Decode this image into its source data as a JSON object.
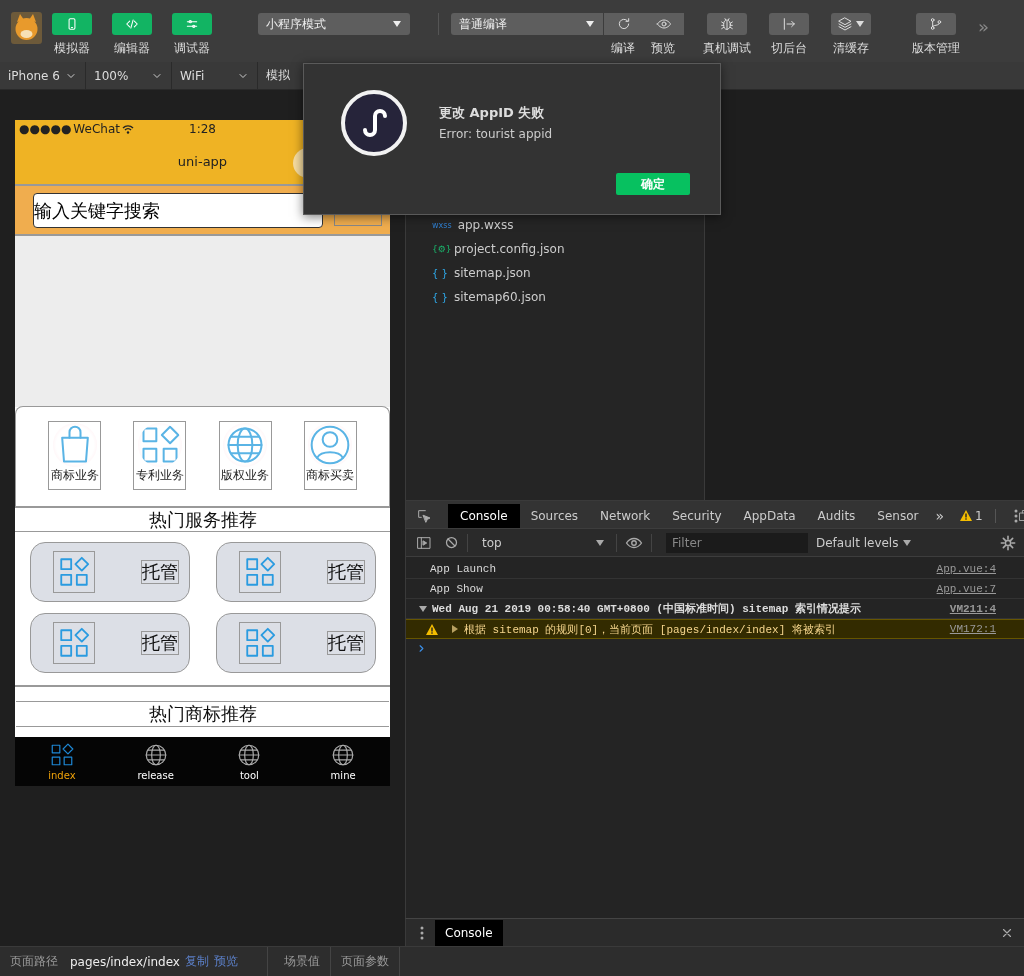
{
  "toolbar": {
    "views": [
      {
        "label": "模拟器",
        "kind": "phone",
        "on": true
      },
      {
        "label": "编辑器",
        "kind": "code",
        "on": true
      },
      {
        "label": "调试器",
        "kind": "sliders",
        "on": true
      }
    ],
    "mode": "小程序模式",
    "compile": {
      "label": "普通编译",
      "actions": [
        {
          "label": "编译",
          "kind": "refresh"
        },
        {
          "label": "预览",
          "kind": "eye"
        }
      ]
    },
    "tools": [
      {
        "label": "真机调试",
        "kind": "bug",
        "menu": false
      },
      {
        "label": "切后台",
        "kind": "exit",
        "menu": false
      },
      {
        "label": "清缓存",
        "kind": "layers",
        "menu": true
      },
      {
        "label": "版本管理",
        "kind": "branch",
        "menu": false
      }
    ],
    "more": "»"
  },
  "device_bar": [
    {
      "label": "iPhone 6",
      "kind": "select"
    },
    {
      "label": "100%",
      "kind": "select"
    },
    {
      "label": "WiFi",
      "kind": "select"
    },
    {
      "label": "模拟",
      "kind": "label"
    }
  ],
  "simulator": {
    "signal": "●●●●●",
    "carrier": "WeChat",
    "time": "1:28",
    "title": "uni-app",
    "search": {
      "placeholder": "输入关键字搜索"
    },
    "categories": [
      {
        "label": "商标业务",
        "kind": "bag"
      },
      {
        "label": "专利业务",
        "kind": "apps"
      },
      {
        "label": "版权业务",
        "kind": "globe"
      },
      {
        "label": "商标买卖",
        "kind": "user"
      }
    ],
    "service_title": "热门服务推荐",
    "services": [
      {
        "label": "托管"
      },
      {
        "label": "托管"
      },
      {
        "label": "托管"
      },
      {
        "label": "托管"
      }
    ],
    "trademark_title": "热门商标推荐",
    "tabs": [
      {
        "label": "index",
        "kind": "apps",
        "selected": true
      },
      {
        "label": "release",
        "kind": "globe",
        "selected": false
      },
      {
        "label": "tool",
        "kind": "globe",
        "selected": false
      },
      {
        "label": "mine",
        "kind": "globe",
        "selected": false
      }
    ]
  },
  "dialog": {
    "title": "更改 AppID 失败",
    "message": "Error: tourist appid",
    "button": "确定"
  },
  "files": [
    {
      "badge": "wxss",
      "name": "app.wxss",
      "kind": "wxss"
    },
    {
      "badge": "{⚙}",
      "name": "project.config.json",
      "kind": "config"
    },
    {
      "badge": "{ }",
      "name": "sitemap.json",
      "kind": "json"
    },
    {
      "badge": "{ }",
      "name": "sitemap60.json",
      "kind": "json"
    }
  ],
  "devtools": {
    "tabs": [
      {
        "label": "Console",
        "selected": true
      },
      {
        "label": "Sources",
        "selected": false
      },
      {
        "label": "Network",
        "selected": false
      },
      {
        "label": "Security",
        "selected": false
      },
      {
        "label": "AppData",
        "selected": false
      },
      {
        "label": "Audits",
        "selected": false
      },
      {
        "label": "Sensor",
        "selected": false
      }
    ],
    "more": "»",
    "warnings": "1",
    "context": "top",
    "filter": {
      "placeholder": "Filter"
    },
    "levels": "Default levels",
    "logs": [
      {
        "kind": "log",
        "text": "App Launch",
        "source": "App.vue:4"
      },
      {
        "kind": "log",
        "text": "App Show",
        "source": "App.vue:7"
      },
      {
        "kind": "group",
        "text": "Wed Aug 21 2019 00:58:40 GMT+0800 (中国标准时间) sitemap 索引情况提示",
        "source": "VM211:4",
        "expanded": true
      },
      {
        "kind": "warning",
        "text": "根据 sitemap 的规则[0]，当前页面 [pages/index/index] 将被索引",
        "source": "VM172:1",
        "expanded": false
      }
    ]
  },
  "drawer": {
    "tabs": [
      {
        "label": "Console",
        "selected": true
      }
    ]
  },
  "status_bar": {
    "path_label": "页面路径",
    "path": "pages/index/index",
    "links": [
      "复制",
      "预览"
    ],
    "fields": [
      "场景值",
      "页面参数"
    ]
  }
}
